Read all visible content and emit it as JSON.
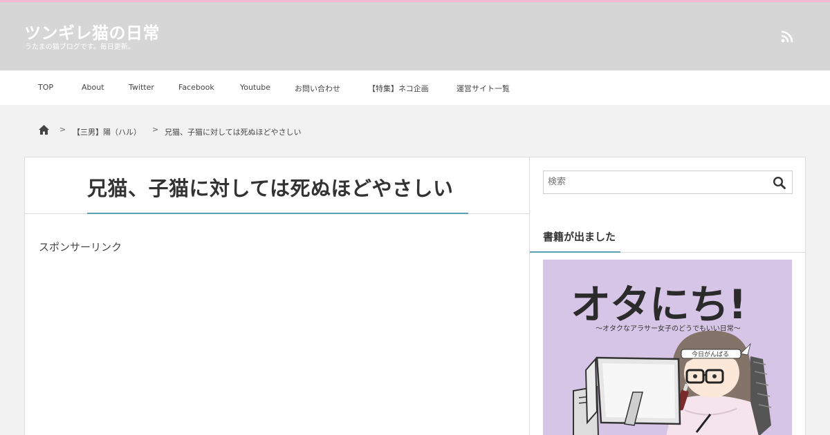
{
  "header": {
    "site_title": "ツンギレ猫の日常",
    "site_description": "うたまの猫ブログです。毎日更新。",
    "rss_icon": "rss-icon"
  },
  "nav": {
    "items": [
      "TOP",
      "About",
      "Twitter",
      "Facebook",
      "Youtube",
      "お問い合わせ",
      "【特集】ネコ企画",
      "運営サイト一覧"
    ]
  },
  "breadcrumb": {
    "home_icon": "home-icon",
    "category": "【三男】陽（ハル）",
    "current": "兄猫、子猫に対しては死ぬほどやさしい",
    "separator": ">"
  },
  "post": {
    "title": "兄猫、子猫に対しては死ぬほどやさしい",
    "sponsor_label": "スポンサーリンク"
  },
  "sidebar": {
    "search_placeholder": "検索",
    "search_icon": "search-icon",
    "widget_title": "書籍が出ました",
    "book": {
      "title": "オタにち!",
      "subtitle": "〜オタクなアラサー女子のどうでもいい日常〜",
      "headband_text": "今日がんばる"
    }
  },
  "colors": {
    "accent": "#5f9fb5",
    "top_line": "#f0b8cf",
    "header_bg": "#d6d6d6",
    "book_bg": "#d6c5e6"
  }
}
